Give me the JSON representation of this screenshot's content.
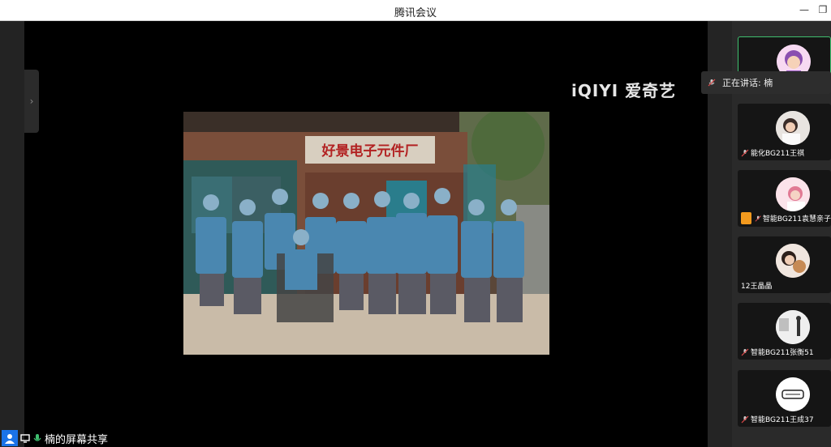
{
  "window": {
    "title": "腾讯会议",
    "minimize": "—",
    "maximize": "❐"
  },
  "stage": {
    "watermark": "iQIYI 爱奇艺",
    "shared_image": {
      "sign_text": "好景电子元件厂",
      "description_icon": "group-photo"
    }
  },
  "collapse_tab": {
    "label": "›"
  },
  "speaking": {
    "label": "正在讲话: 楠"
  },
  "participants": [
    {
      "name": "",
      "muted": false,
      "avatar": "cartoon-girl",
      "active": true
    },
    {
      "name": "能化BG211王祺",
      "muted": true,
      "avatar": "girl-photo"
    },
    {
      "name": "智能BG211袁慧亲子",
      "muted": true,
      "avatar": "pink-photo",
      "badge": true
    },
    {
      "name": "12王晶晶",
      "muted": false,
      "avatar": "teddy-photo"
    },
    {
      "name": "智能BG211张衡51",
      "muted": true,
      "avatar": "room-photo"
    },
    {
      "name": "智能BG211王成37",
      "muted": true,
      "avatar": "cartoon-face"
    }
  ],
  "bottombar": {
    "share_label": "楠的屏幕共享"
  },
  "colors": {
    "accent": "#1a73e8",
    "active_border": "#3fbf6f",
    "mic_muted": "#e04b4b"
  }
}
